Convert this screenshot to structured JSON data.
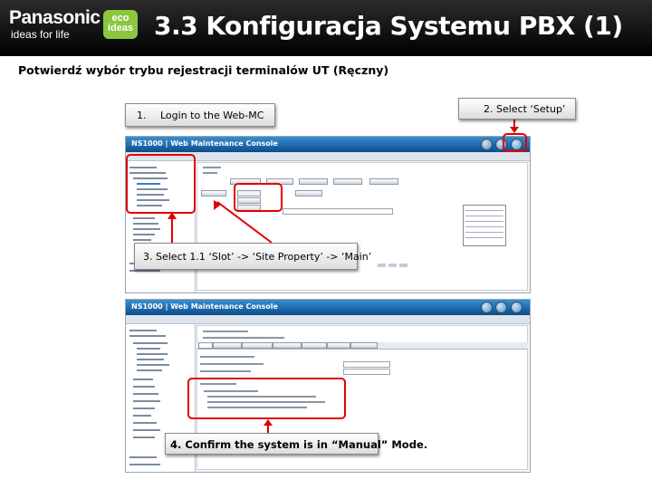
{
  "header": {
    "brand": "Panasonic",
    "tagline": "ideas for life",
    "eco_badge": "eco ideas",
    "title": "3.3 Konfiguracja Systemu PBX (1)"
  },
  "subtitle": "Potwierdź wybór trybu rejestracji terminalów UT (Ręczny)",
  "callouts": {
    "step1_number": "1.",
    "step1_text": "Login to the Web-MC",
    "step2": "2. Select ‘Setup’",
    "step3": "3. Select 1.1 ‘Slot’ -> ‘Site Property’ -> ‘Main’",
    "step4": "4. Confirm the system is in “Manual” Mode."
  },
  "screenshots": {
    "app_title": "NS1000 | Web Maintenance Console"
  },
  "colors": {
    "header_bg": "#000000",
    "eco_green": "#8cc63f",
    "highlight_red": "#e00000",
    "app_bar_blue": "#1565a8"
  }
}
